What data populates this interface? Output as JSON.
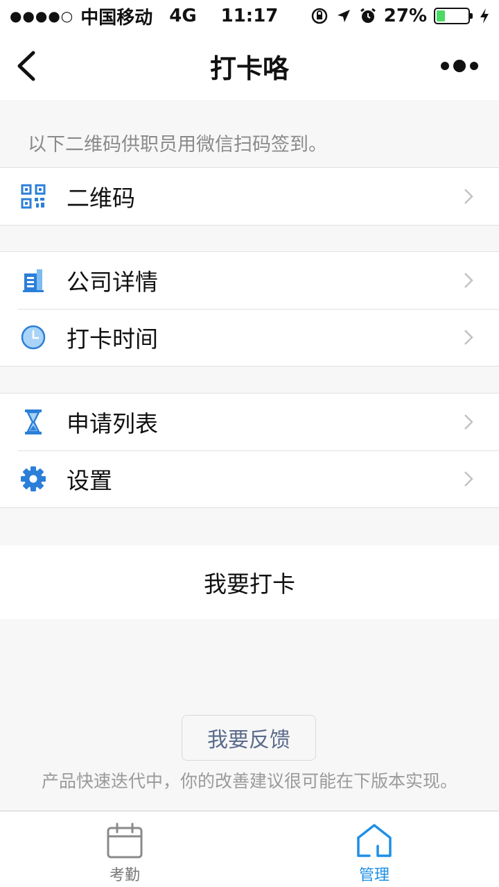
{
  "status_bar": {
    "signal": "●●●●○",
    "carrier": "中国移动",
    "network": "4G",
    "time": "11:17",
    "battery_percent": "27%",
    "battery_level": 0.27
  },
  "nav": {
    "title": "打卡咯",
    "back_icon": "chevron-left-icon",
    "more_icon": "more-dots-icon"
  },
  "hint": "以下二维码供职员用微信扫码签到。",
  "menu_groups": [
    {
      "items": [
        {
          "label": "二维码",
          "icon": "qrcode-icon"
        }
      ]
    },
    {
      "items": [
        {
          "label": "公司详情",
          "icon": "building-icon"
        },
        {
          "label": "打卡时间",
          "icon": "clock-icon"
        }
      ]
    },
    {
      "items": [
        {
          "label": "申请列表",
          "icon": "hourglass-icon"
        },
        {
          "label": "设置",
          "icon": "gear-icon"
        }
      ]
    }
  ],
  "action": {
    "clock_in_label": "我要打卡"
  },
  "feedback": {
    "button_label": "我要反馈",
    "footnote": "产品快速迭代中，你的改善建议很可能在下版本实现。"
  },
  "tabs": [
    {
      "label": "考勤",
      "icon": "calendar-icon",
      "active": false
    },
    {
      "label": "管理",
      "icon": "home-icon",
      "active": true
    }
  ],
  "colors": {
    "accent": "#1f8fe5",
    "icon_blue": "#2b7fd8",
    "battery_green": "#4cd964",
    "hint_gray": "#8a8a8a"
  }
}
